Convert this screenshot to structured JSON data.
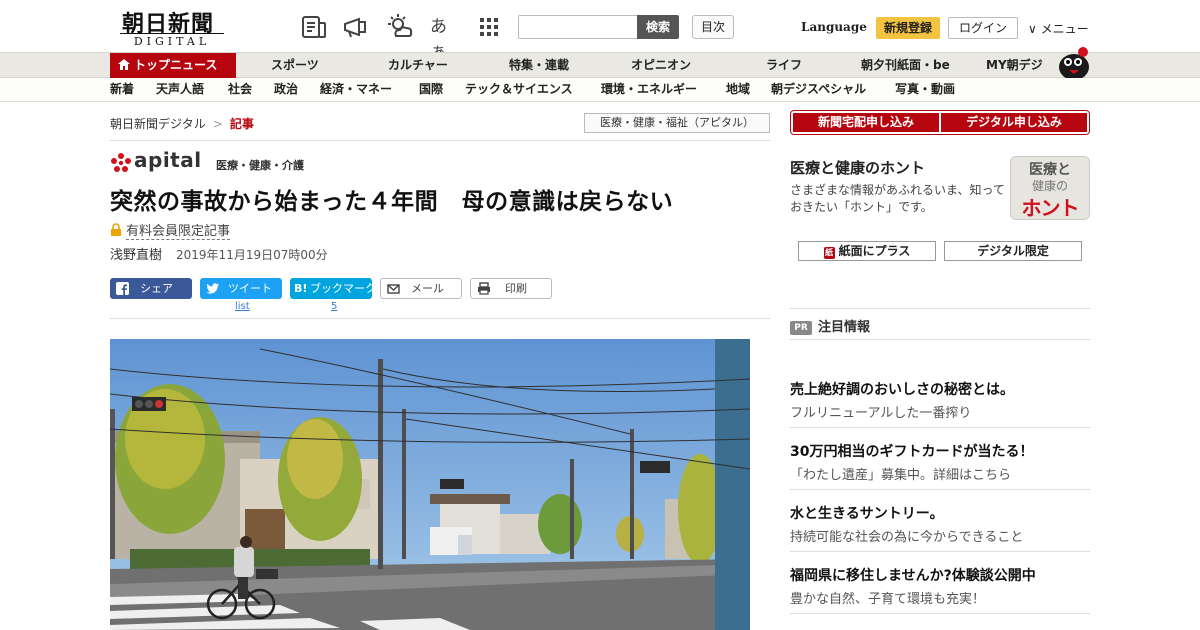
{
  "header": {
    "logo_kanji": "朝日新聞",
    "logo_sub": "DIGITAL",
    "search_placeholder": "",
    "search_button": "検索",
    "toc_button": "目次",
    "language": "Language",
    "register": "新規登録",
    "login": "ログイン",
    "menu": "∨ メニュー",
    "icons": [
      "newspaper-icon",
      "megaphone-icon",
      "weather-icon",
      "font-size-icon",
      "grid-icon"
    ],
    "font_size_glyph": "あぁ"
  },
  "nav_main": [
    "トップニュース",
    "スポーツ",
    "カルチャー",
    "特集・連載",
    "オピニオン",
    "ライフ",
    "朝夕刊紙面・be",
    "MY朝デジ"
  ],
  "nav_sub": [
    "新着",
    "天声人語",
    "社会",
    "政治",
    "経済・マネー",
    "国際",
    "テック＆サイエンス",
    "環境・エネルギー",
    "地域",
    "朝デジスペシャル",
    "写真・動画"
  ],
  "breadcrumb": {
    "home": "朝日新聞デジタル",
    "sep": ">",
    "current": "記事"
  },
  "category_box": "医療・健康・福祉（アピタル）",
  "apital": {
    "wordmark": "apital",
    "tagline": "医療・健康・介護"
  },
  "article": {
    "headline": "突然の事故から始まった４年間　母の意識は戻らない",
    "members_only": "有料会員限定記事",
    "author": "浅野直樹",
    "date": "2019年11月19日07時00分"
  },
  "share": {
    "facebook": "シェア",
    "twitter": "ツイート",
    "hatena": "ブックマーク",
    "mail": "メール",
    "print": "印刷",
    "twitter_count": "list",
    "hatena_count": "5"
  },
  "sidebar": {
    "subscribe_paper": "新聞宅配申し込み",
    "subscribe_digital": "デジタル申し込み",
    "honto_title": "医療と健康のホント",
    "honto_desc": "さまざまな情報があふれるいま、知っておきたい「ホント」です。",
    "honto_logo_l1": "医療と",
    "honto_logo_l2": "健康の",
    "honto_logo_l3": "ホント",
    "btn_paper_plus": "紙面にプラス",
    "btn_paper_plus_icon": "紙",
    "btn_digital_only": "デジタル限定",
    "pr_badge": "PR",
    "pr_heading": "注目情報",
    "ads": [
      {
        "title": "売上絶好調のおいしさの秘密とは。",
        "desc": "フルリニューアルした一番搾り"
      },
      {
        "title": "30万円相当のギフトカードが当たる！",
        "desc": "「わたし遺産」募集中。詳細はこちら"
      },
      {
        "title": "水と生きるサントリー。",
        "desc": "持続可能な社会の為に今からできること"
      },
      {
        "title": "福岡県に移住しませんか?体験談公開中",
        "desc": "豊かな自然、子育て環境も充実！"
      }
    ]
  },
  "colors": {
    "brand_red": "#b7050f",
    "register_yellow": "#f5c342",
    "facebook": "#3b5998",
    "twitter": "#1da1f2",
    "hatena": "#00a4de"
  }
}
